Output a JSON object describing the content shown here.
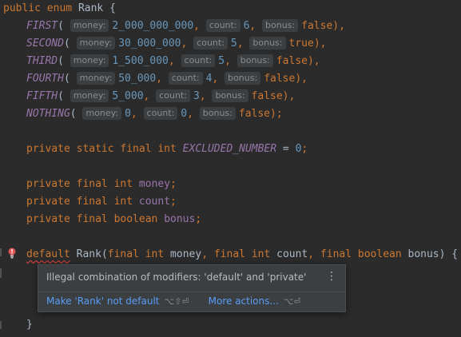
{
  "code": {
    "enum_decl": {
      "kw1": "public",
      "kw2": "enum",
      "name": "Rank",
      "brace": "{"
    },
    "hint_labels": {
      "money": "money:",
      "count": "count:",
      "bonus": "bonus:"
    },
    "constants": [
      {
        "name": "FIRST",
        "money": "2_000_000_000",
        "count": "6",
        "bonus": "false",
        "end": "),"
      },
      {
        "name": "SECOND",
        "money": "30_000_000",
        "count": "5",
        "bonus": "true",
        "end": "),"
      },
      {
        "name": "THIRD",
        "money": "1_500_000",
        "count": "5",
        "bonus": "false",
        "end": "),"
      },
      {
        "name": "FOURTH",
        "money": "50_000",
        "count": "4",
        "bonus": "false",
        "end": "),"
      },
      {
        "name": "FIFTH",
        "money": "5_000",
        "count": "3",
        "bonus": "false",
        "end": "),"
      },
      {
        "name": "NOTHING",
        "money": "0",
        "count": "0",
        "bonus": "false",
        "end": ");"
      }
    ],
    "excluded": {
      "mods": "private static final int",
      "name": "EXCLUDED_NUMBER",
      "eq": "=",
      "value": "0",
      "semi": ";"
    },
    "fields": [
      {
        "mods": "private final int",
        "name": "money",
        "semi": ";"
      },
      {
        "mods": "private final int",
        "name": "count",
        "semi": ";"
      },
      {
        "mods": "private final boolean",
        "name": "bonus",
        "semi": ";"
      }
    ],
    "constructor": {
      "default_kw": "default",
      "name": "Rank",
      "p1_mods": "final int",
      "p1": "money",
      "p2_mods": "final int",
      "p2": "count",
      "p3_mods": "final boolean",
      "p3": "bonus",
      "open": "(",
      "close": ") {"
    },
    "closing_brace": "}"
  },
  "popup": {
    "message": "Illegal combination of modifiers: 'default' and 'private'",
    "more_icon": "⋮",
    "action1": "Make 'Rank' not default",
    "action1_shortcut": "⌥⇧⏎",
    "action2": "More actions...",
    "action2_shortcut": "⌥⏎"
  },
  "icons": {
    "error": "error-bulb-icon"
  },
  "colors": {
    "keyword": "#cc7832",
    "constant": "#9876aa",
    "number": "#6897bb",
    "link": "#589df6",
    "error": "#bc3f3c"
  }
}
